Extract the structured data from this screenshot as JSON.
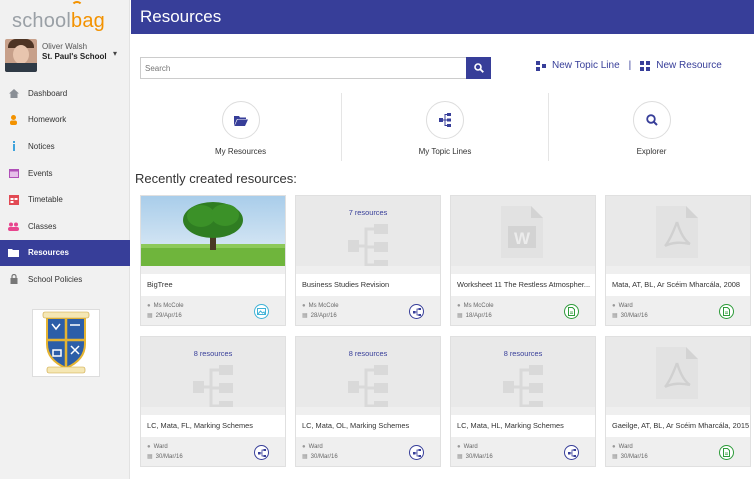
{
  "app": {
    "page_title": "Resources",
    "user_name": "Oliver Walsh",
    "user_school": "St. Paul's School",
    "user_caret": "▾",
    "crest_motto": "Melli Erit Origo"
  },
  "nav": [
    {
      "label": "Dashboard",
      "icon": "home-icon"
    },
    {
      "label": "Homework",
      "icon": "person-icon"
    },
    {
      "label": "Notices",
      "icon": "info-icon"
    },
    {
      "label": "Events",
      "icon": "calendar-icon"
    },
    {
      "label": "Timetable",
      "icon": "timetable-icon"
    },
    {
      "label": "Classes",
      "icon": "group-icon"
    },
    {
      "label": "Resources",
      "icon": "folder-icon",
      "active": true
    },
    {
      "label": "School Policies",
      "icon": "lock-icon"
    }
  ],
  "search": {
    "placeholder": "Search"
  },
  "actions": {
    "new_topic_line": "New Topic Line",
    "separator": "|",
    "new_resource": "New Resource"
  },
  "quick_links": [
    {
      "label": "My Resources",
      "icon": "folder-open-icon"
    },
    {
      "label": "My Topic Lines",
      "icon": "topic-tree-icon"
    },
    {
      "label": "Explorer",
      "icon": "search-icon"
    }
  ],
  "section_title": "Recently created resources:",
  "cards": [
    {
      "title": "BigTree",
      "author": "Ms McCole",
      "date": "29/Apr/16",
      "thumb": "image",
      "badge": "image-icon",
      "badge_color": "#3fb2d6"
    },
    {
      "title": "Business Studies Revision",
      "author": "Ms McCole",
      "date": "28/Apr/16",
      "thumb": "topic",
      "count": "7 resources",
      "badge": "topic-line-icon",
      "badge_color": "#373e99"
    },
    {
      "title": "Worksheet 11 The Restless Atmospher...",
      "author": "Ms McCole",
      "date": "18/Apr/16",
      "thumb": "word",
      "badge": "document-icon",
      "badge_color": "#2e9b3a"
    },
    {
      "title": "Mata, AT, BL, Ar Scéim Mharcála, 2008",
      "author": "Ward",
      "date": "30/Mar/16",
      "thumb": "pdf",
      "badge": "document-icon",
      "badge_color": "#2e9b3a"
    },
    {
      "title": "LC, Mata, FL, Marking Schemes",
      "author": "Ward",
      "date": "30/Mar/16",
      "thumb": "topic",
      "count": "8 resources",
      "badge": "topic-line-icon",
      "badge_color": "#373e99"
    },
    {
      "title": "LC, Mata, OL, Marking Schemes",
      "author": "Ward",
      "date": "30/Mar/16",
      "thumb": "topic",
      "count": "8 resources",
      "badge": "topic-line-icon",
      "badge_color": "#373e99"
    },
    {
      "title": "LC, Mata, HL, Marking Schemes",
      "author": "Ward",
      "date": "30/Mar/16",
      "thumb": "topic",
      "count": "8 resources",
      "badge": "topic-line-icon",
      "badge_color": "#373e99"
    },
    {
      "title": "Gaeilge, AT, BL, Ar Scéim Mharcála, 2015",
      "author": "Ward",
      "date": "30/Mar/16",
      "thumb": "pdf",
      "badge": "document-icon",
      "badge_color": "#2e9b3a"
    }
  ],
  "colors": {
    "brand": "#373e99",
    "accent": "#f39200"
  }
}
